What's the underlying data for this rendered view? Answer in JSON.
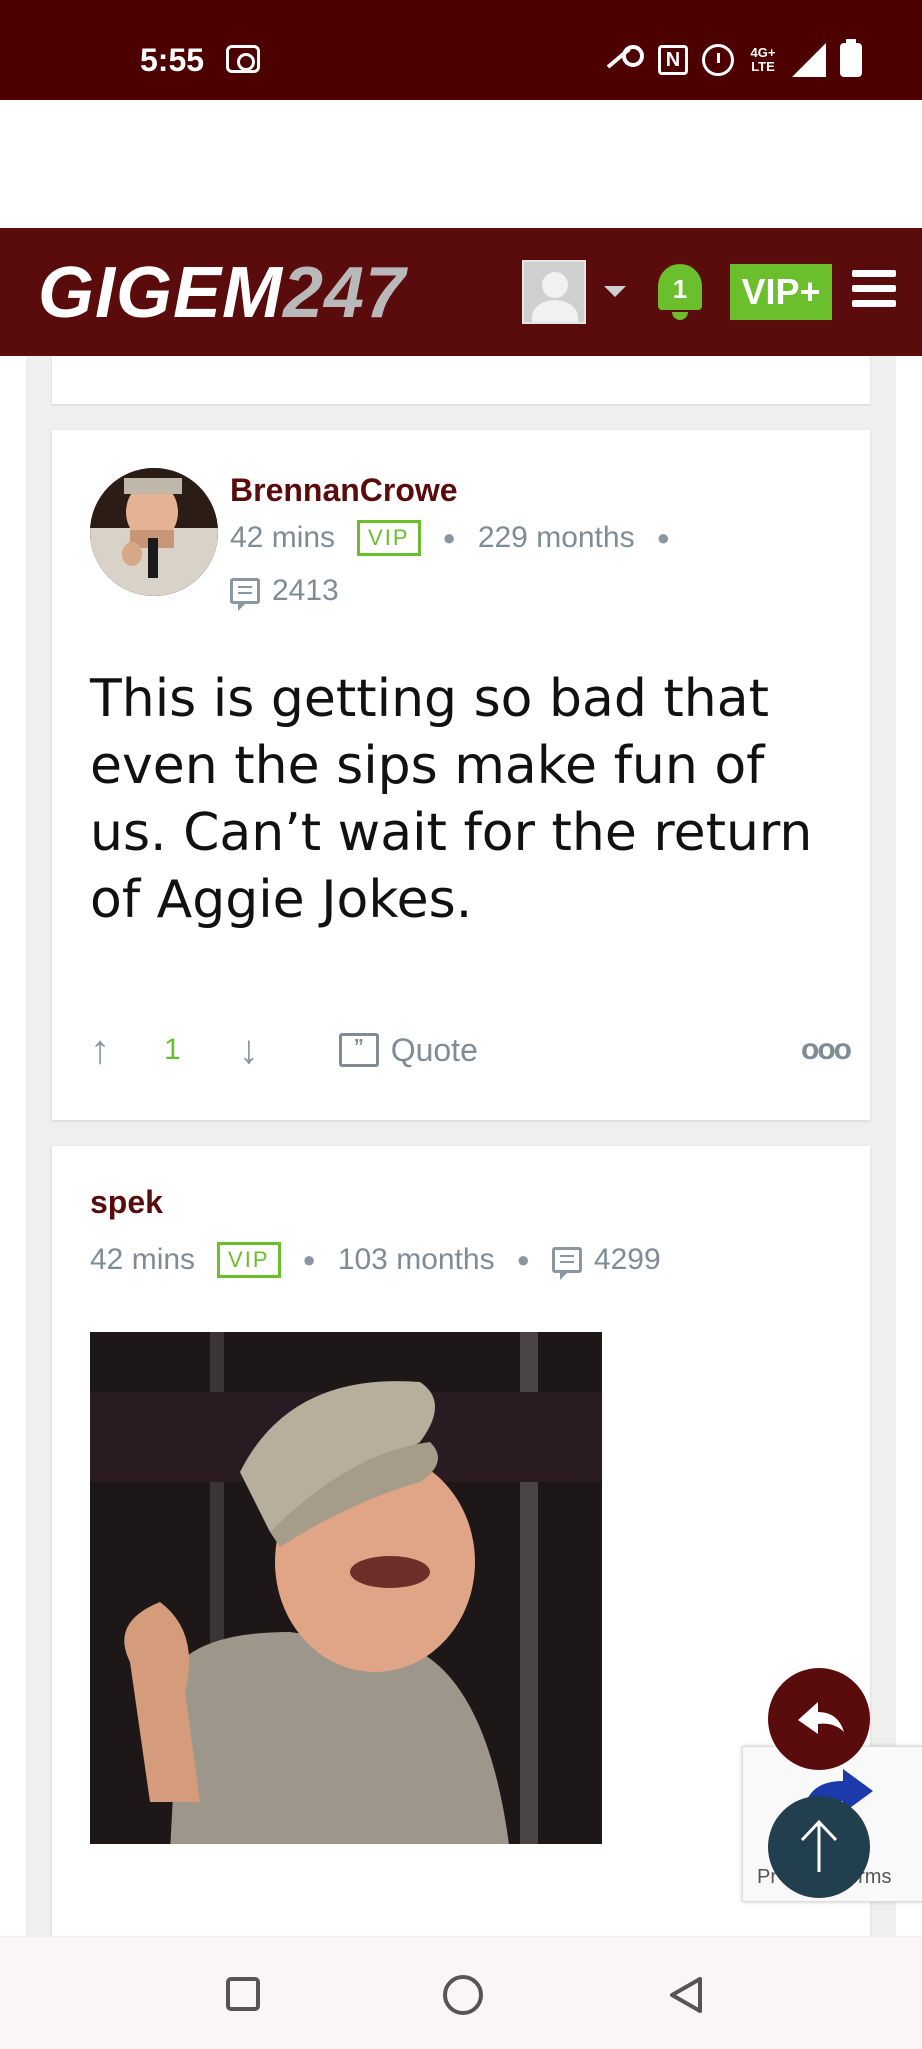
{
  "status_bar": {
    "time": "5:55",
    "network": "4G+ LTE",
    "icons": [
      "screen-record-icon",
      "key-icon",
      "nfc-icon",
      "alarm-icon",
      "signal-icon",
      "battery-icon"
    ]
  },
  "header": {
    "logo_main": "GIGEM",
    "logo_num": "247",
    "notification_count": "1",
    "vip_label": "VIP+",
    "colors": {
      "brand": "#5a0b0b",
      "accent_green": "#6bbf2c"
    }
  },
  "posts": [
    {
      "username": "BrennanCrowe",
      "time": "42 mins",
      "badge": "VIP",
      "tenure": "229 months",
      "post_count": "2413",
      "text": "This is getting so bad that even the sips make fun of us. Can’t wait for the return of Aggie Jokes.",
      "votes": "1",
      "quote_label": "Quote",
      "more_label": "ooo"
    },
    {
      "username": "spek",
      "time": "42 mins",
      "badge": "VIP",
      "tenure": "103 months",
      "post_count": "4299"
    }
  ],
  "recaptcha": {
    "text_left": "Pr",
    "text_right": "erms"
  },
  "nav": {
    "icons": [
      "recent-apps-icon",
      "home-icon",
      "back-icon"
    ]
  }
}
